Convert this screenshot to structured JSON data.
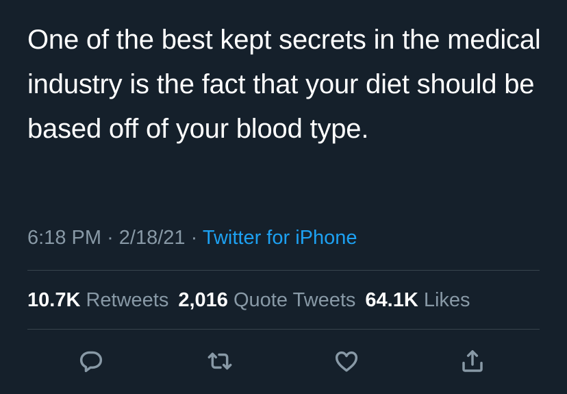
{
  "tweet": {
    "text": "One of the best kept secrets in the medical industry is the fact that your diet should be based off of your blood type.",
    "time": "6:18 PM",
    "date": "2/18/21",
    "source": "Twitter for iPhone",
    "separator": "·"
  },
  "stats": {
    "retweets_count": "10.7K",
    "retweets_label": "Retweets",
    "quotes_count": "2,016",
    "quotes_label": "Quote Tweets",
    "likes_count": "64.1K",
    "likes_label": "Likes"
  },
  "actions": {
    "reply_icon": "reply-icon",
    "retweet_icon": "retweet-icon",
    "like_icon": "heart-icon",
    "share_icon": "share-icon"
  },
  "colors": {
    "background": "#15202b",
    "text": "#ffffff",
    "secondary": "#8899a6",
    "accent": "#1da1f2",
    "divider": "#38444d"
  }
}
